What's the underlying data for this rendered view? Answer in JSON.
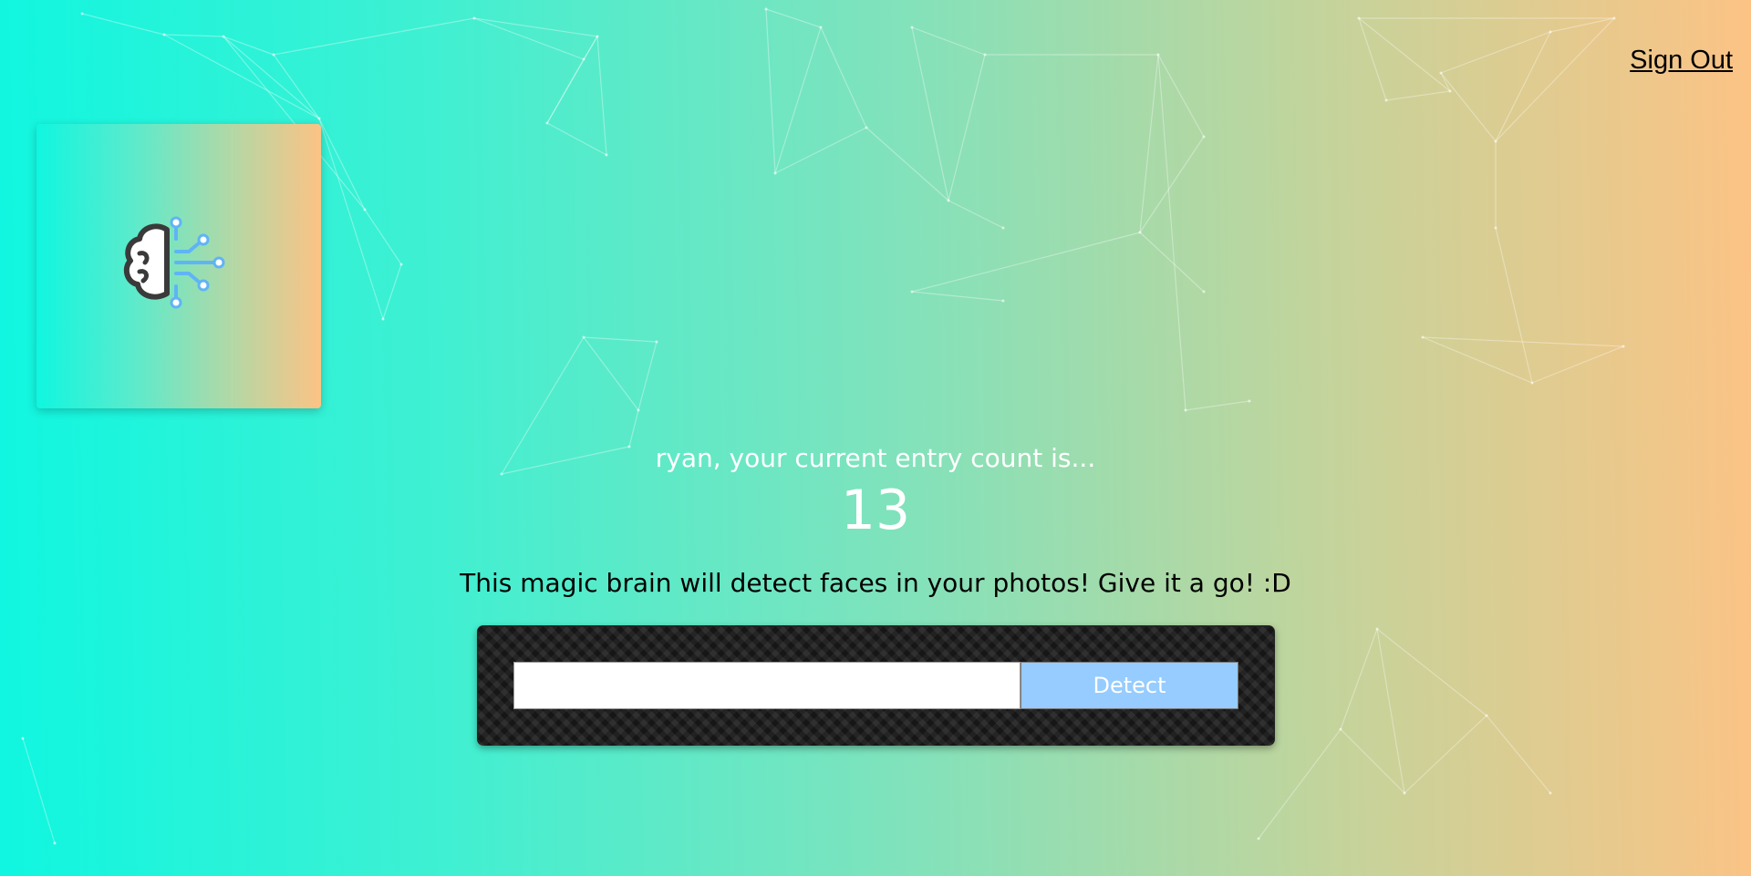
{
  "header": {
    "signout_label": "Sign Out"
  },
  "logo": {
    "icon": "brain-circuit-icon",
    "brain_stroke": "#3a3a3a",
    "circuit_color": "#5fb4f5"
  },
  "rank": {
    "message": "ryan, your current entry count is...",
    "count": "13"
  },
  "tagline": "This magic brain will detect faces in your photos! Give it a go! :D",
  "form": {
    "input_value": "",
    "input_placeholder": "",
    "detect_label": "Detect"
  },
  "colors": {
    "gradient_start": "#10f6e0",
    "gradient_end": "#fcc385",
    "button_bg": "#96ccff",
    "panel_bg": "#1c1c1c"
  }
}
